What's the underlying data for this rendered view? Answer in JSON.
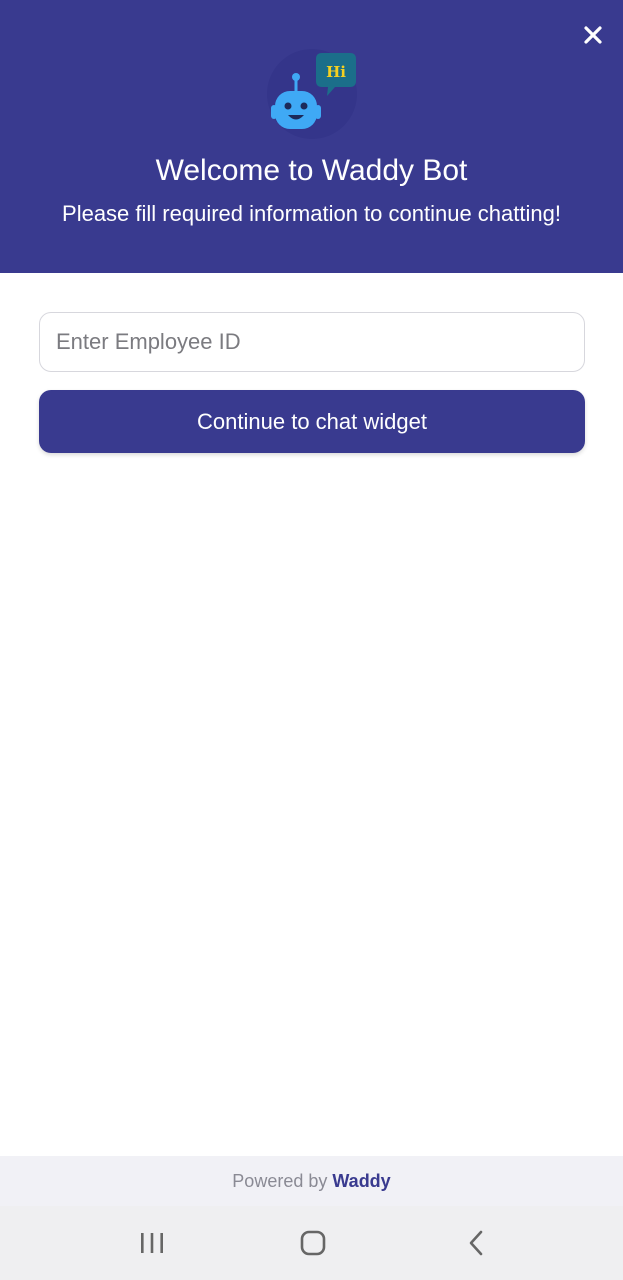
{
  "header": {
    "title": "Welcome to Waddy Bot",
    "subtitle": "Please fill required information to continue chatting!",
    "background_color": "#393a8f",
    "logo_bubble_text": "Hi",
    "close_icon": "close-icon"
  },
  "form": {
    "employee_id": {
      "placeholder": "Enter Employee ID",
      "value": ""
    },
    "continue_label": "Continue to chat widget"
  },
  "footer": {
    "powered_prefix": "Powered by",
    "brand": "Waddy"
  },
  "system_nav": {
    "recents_icon": "recents-icon",
    "home_icon": "home-icon",
    "back_icon": "back-icon"
  },
  "colors": {
    "accent": "#393a8f",
    "robot_blue": "#3fa9f5",
    "bubble_teal": "#1b6e8a",
    "bubble_text": "#f5d020"
  }
}
